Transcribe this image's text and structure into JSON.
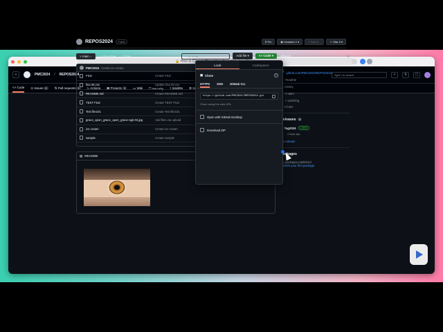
{
  "browser": {
    "title": "How to Clone a Repository from Github in Ubuntu",
    "colors": {
      "close": "#ff5f57",
      "min": "#febc2e",
      "max": "#28c840"
    }
  },
  "top": {
    "owner": "PMC2024",
    "sep": "/",
    "repo": "REPOS2024",
    "search": "Type / to search",
    "plus": "+",
    "pulls": "⇅",
    "inbox": "▢"
  },
  "repo_nav": [
    {
      "label": "Code",
      "count": ""
    },
    {
      "label": "Issues",
      "count": "1"
    },
    {
      "label": "Pull requests",
      "count": "1"
    },
    {
      "label": "Actions",
      "count": ""
    },
    {
      "label": "Projects",
      "count": "1"
    },
    {
      "label": "Wiki",
      "count": ""
    },
    {
      "label": "Security",
      "count": ""
    },
    {
      "label": "Insights",
      "count": ""
    },
    {
      "label": "Settings",
      "count": ""
    }
  ],
  "repo": {
    "name": "REPOS2024",
    "visibility": "Public",
    "pin": "Pin",
    "unwatch": "Unwatch",
    "unwatch_count": "1",
    "fork": "Fork",
    "fork_count": "0",
    "star": "Star",
    "star_count": "0"
  },
  "bar": {
    "branch": "main",
    "branches": "4 Branches",
    "tags": "2 Tags",
    "goto": "Go to file",
    "add": "Add file",
    "code": "Code"
  },
  "commit": {
    "user": "PMC2024",
    "message": "Create ice cream"
  },
  "files": [
    {
      "name": "FILE",
      "msg": "Create FILE",
      "age": ""
    },
    {
      "name": "lina 06.csv",
      "msg": "Update lina 05.csv",
      "age": ""
    },
    {
      "name": "README.md",
      "msg": "Create README.md",
      "age": ""
    },
    {
      "name": "TEST FILE",
      "msg": "Create TEST FILE",
      "age": ""
    },
    {
      "name": "Test file101",
      "msg": "Create Test file101",
      "age": ""
    },
    {
      "name": "grace_upon_grace_upon_grace-sgk-03.jpg",
      "msg": "Add files via upload",
      "age": ""
    },
    {
      "name": "ice cream",
      "msg": "Create ice cream",
      "age": "4 hours ago"
    },
    {
      "name": "sample",
      "msg": "Create sample",
      "age": "4 days ago"
    }
  ],
  "readme": {
    "title": "README"
  },
  "about": {
    "heading": "About",
    "desc": "repo",
    "link": "github.com/PMC2024/REPOS2024",
    "readme": "Readme",
    "activity": "Activity",
    "stars": "0 stars",
    "watching": "1 watching",
    "forks": "0 forks"
  },
  "releases": {
    "heading": "Releases",
    "count": "2",
    "tag": "Tag2024",
    "latest": "Latest",
    "date": "4 days ago",
    "more": "+ 1 release"
  },
  "packages": {
    "heading": "Packages",
    "none": "No packages published",
    "publish": "Publish your first package"
  },
  "popup": {
    "tab_local": "Local",
    "tab_codespaces": "Codespaces",
    "clone": "Clone",
    "https": "HTTPS",
    "ssh": "SSH",
    "cli": "GitHub CLI",
    "url": "https://github.com/PMC2024/REPOS2024.git",
    "hint": "Clone using the web URL.",
    "desktop": "Open with GitHub Desktop",
    "zip": "Download ZIP"
  }
}
